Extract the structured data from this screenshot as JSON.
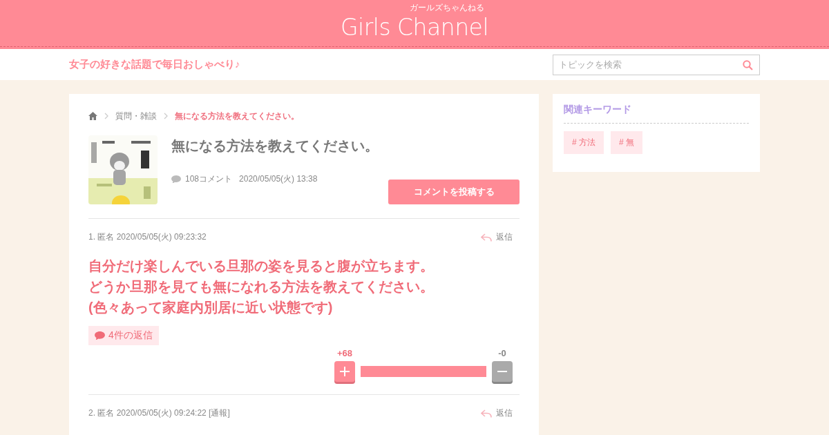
{
  "header": {
    "logo": "Girls Channel",
    "logo_kana": "ガールズちゃんねる"
  },
  "subheader": {
    "tagline": "女子の好きな話題で毎日おしゃべり♪",
    "search": {
      "placeholder": "トピックを検索"
    }
  },
  "breadcrumb": [
    "質問・雑談",
    "無になる方法を教えてください。"
  ],
  "topic": {
    "title": "無になる方法を教えてください。",
    "comment_count": "108コメント",
    "date": "2020/05/05(火) 13:38",
    "post_button": "コメントを投稿する"
  },
  "comments": [
    {
      "meta": "1. 匿名 2020/05/05(火) 09:23:32",
      "reply": "返信",
      "body": [
        "自分だけ楽しんでいる旦那の姿を見ると腹が立ちます。",
        "どうか旦那を見ても無になれる方法を教えてください。",
        "(色々あって家庭内別居に近い状態です)"
      ],
      "replies": "4件の返信",
      "plus": "+68",
      "minus": "-0",
      "level": 1
    },
    {
      "meta": "2. 匿名 2020/05/05(火) 09:24:22 [通報]",
      "reply": "返信"
    }
  ],
  "sidebar": {
    "title": "関連キーワード",
    "tags": [
      "# 方法",
      "# 無"
    ]
  }
}
